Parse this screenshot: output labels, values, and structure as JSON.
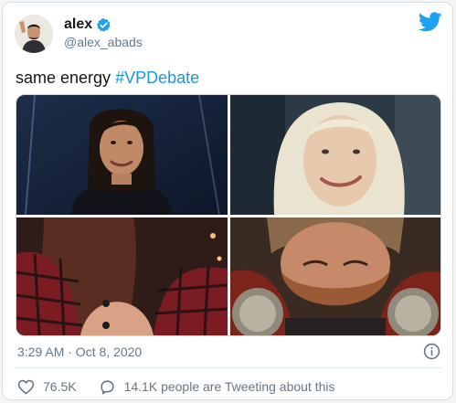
{
  "tweet": {
    "author": {
      "display_name": "alex",
      "handle": "@alex_abads",
      "verified": true,
      "avatar_icon": "avatar"
    },
    "text": "same energy",
    "hashtag": "#VPDebate",
    "timestamp": "3:29 AM · Oct 8, 2020",
    "likes": "76.5K",
    "tweeting_about": "14.1K people are Tweeting about this",
    "media": [
      {
        "icon": "photo-woman-dark-hair-smiling"
      },
      {
        "icon": "photo-woman-blonde-smirking"
      },
      {
        "icon": "photo-woman-red-plaid-jacket"
      },
      {
        "icon": "photo-bearded-man-armor"
      }
    ]
  },
  "icons": {
    "brand": "twitter-bird-icon",
    "verified": "verified-badge-icon",
    "info": "info-icon",
    "like": "heart-icon",
    "reply": "comment-bubble-icon"
  },
  "colors": {
    "accent": "#1da1f2",
    "hashtag": "#1b95e0",
    "text": "#14171a",
    "secondary_text": "#657786"
  }
}
